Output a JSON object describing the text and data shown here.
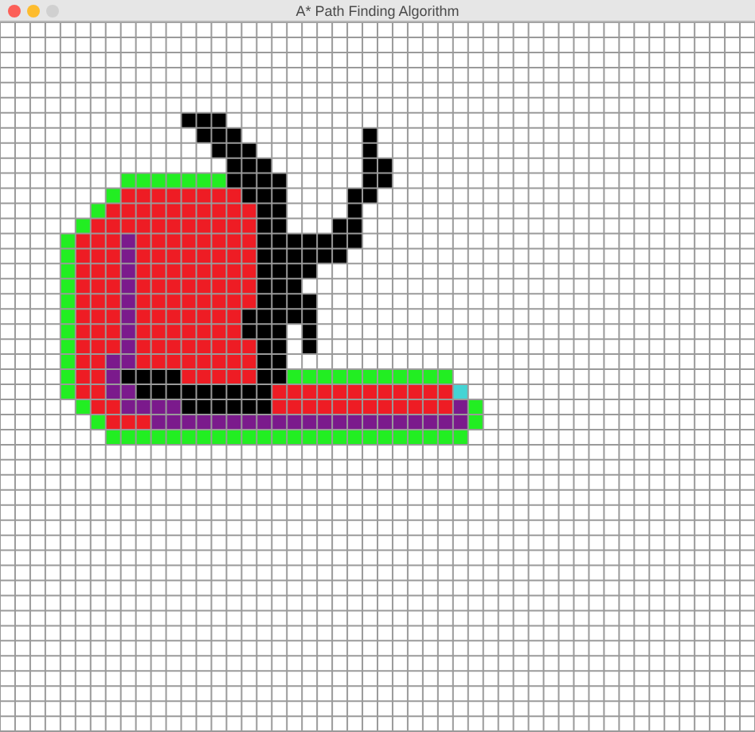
{
  "window": {
    "title": "A* Path Finding Algorithm"
  }
}
